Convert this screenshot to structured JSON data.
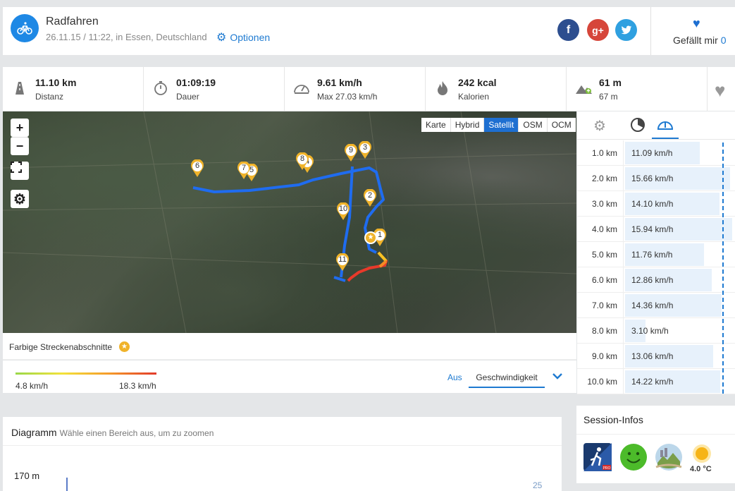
{
  "activity": {
    "title": "Radfahren",
    "subtitle": "26.11.15 / 11:22, in Essen, Deutschland",
    "options_label": "Optionen",
    "icon": "bicycle-icon"
  },
  "social": {
    "facebook": "f",
    "googleplus": "g+",
    "twitter": "twitter-bird-icon"
  },
  "like": {
    "label": "Gefällt mir",
    "count": "0"
  },
  "stats": [
    {
      "icon": "road-icon",
      "value": "11.10 km",
      "label": "Distanz"
    },
    {
      "icon": "stopwatch-icon",
      "value": "01:09:19",
      "label": "Dauer"
    },
    {
      "icon": "speedometer-icon",
      "value": "9.61 km/h",
      "label": "Max 27.03 km/h"
    },
    {
      "icon": "flame-icon",
      "value": "242 kcal",
      "label": "Kalorien"
    },
    {
      "icon": "mountain-icon",
      "value": "61 m",
      "label": "67 m"
    }
  ],
  "map": {
    "zoom_in": "+",
    "zoom_out": "−",
    "layers": [
      "Karte",
      "Hybrid",
      "Satellit",
      "OSM",
      "OCM"
    ],
    "active_layer": "Satellit",
    "markers": [
      "1",
      "2",
      "3",
      "4",
      "5",
      "6",
      "7",
      "8",
      "9",
      "10",
      "11"
    ]
  },
  "legend": {
    "segments_label": "Farbige Streckenabschnitte",
    "min": "4.8 km/h",
    "max": "18.3 km/h",
    "off_label": "Aus",
    "mode_label": "Geschwindigkeit"
  },
  "splits": [
    {
      "km": "1.0 km",
      "speed": "11.09 km/h",
      "frac": 0.7
    },
    {
      "km": "2.0 km",
      "speed": "15.66 km/h",
      "frac": 0.98
    },
    {
      "km": "3.0 km",
      "speed": "14.10 km/h",
      "frac": 0.88
    },
    {
      "km": "4.0 km",
      "speed": "15.94 km/h",
      "frac": 1.0
    },
    {
      "km": "5.0 km",
      "speed": "11.76 km/h",
      "frac": 0.74
    },
    {
      "km": "6.0 km",
      "speed": "12.86 km/h",
      "frac": 0.81
    },
    {
      "km": "7.0 km",
      "speed": "14.36 km/h",
      "frac": 0.9
    },
    {
      "km": "8.0 km",
      "speed": "3.10 km/h",
      "frac": 0.19
    },
    {
      "km": "9.0 km",
      "speed": "13.06 km/h",
      "frac": 0.82
    },
    {
      "km": "10.0 km",
      "speed": "14.22 km/h",
      "frac": 0.89
    }
  ],
  "diagram": {
    "title": "Diagramm",
    "hint": "Wähle einen Bereich aus, um zu zoomen",
    "y_left": "170 m",
    "y_right": "25"
  },
  "session": {
    "title": "Session-Infos",
    "temperature": "4.0 °C"
  }
}
